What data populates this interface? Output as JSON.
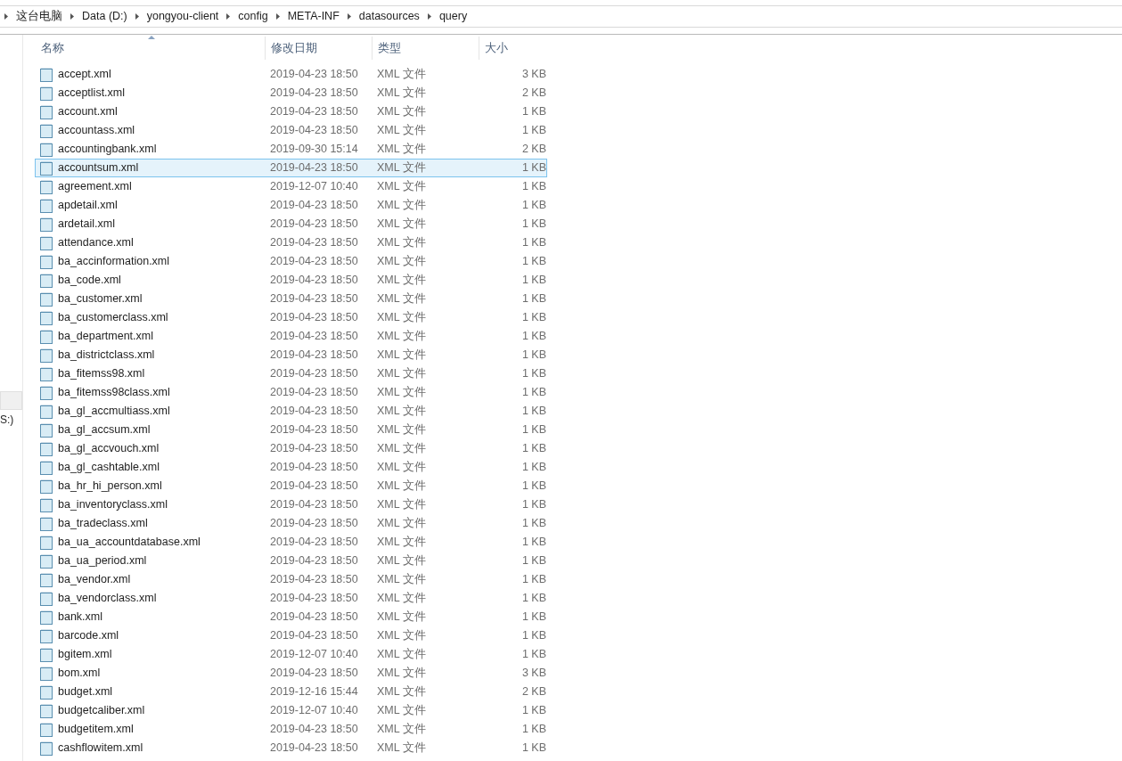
{
  "breadcrumb": [
    "这台电脑",
    "Data (D:)",
    "yongyou-client",
    "config",
    "META-INF",
    "datasources",
    "query"
  ],
  "sidebar": {
    "items": [
      {
        "selected": true
      },
      {
        "label": "S:)",
        "selected": false
      }
    ]
  },
  "table": {
    "columns": [
      {
        "label": "名称",
        "sorted": true
      },
      {
        "label": "修改日期",
        "sorted": false
      },
      {
        "label": "类型",
        "sorted": false
      },
      {
        "label": "大小",
        "sorted": false
      }
    ],
    "rows": [
      {
        "name": "accept.xml",
        "date": "2019-04-23 18:50",
        "type": "XML 文件",
        "size": "3 KB",
        "selected": false
      },
      {
        "name": "acceptlist.xml",
        "date": "2019-04-23 18:50",
        "type": "XML 文件",
        "size": "2 KB",
        "selected": false
      },
      {
        "name": "account.xml",
        "date": "2019-04-23 18:50",
        "type": "XML 文件",
        "size": "1 KB",
        "selected": false
      },
      {
        "name": "accountass.xml",
        "date": "2019-04-23 18:50",
        "type": "XML 文件",
        "size": "1 KB",
        "selected": false
      },
      {
        "name": "accountingbank.xml",
        "date": "2019-09-30 15:14",
        "type": "XML 文件",
        "size": "2 KB",
        "selected": false
      },
      {
        "name": "accountsum.xml",
        "date": "2019-04-23 18:50",
        "type": "XML 文件",
        "size": "1 KB",
        "selected": true
      },
      {
        "name": "agreement.xml",
        "date": "2019-12-07 10:40",
        "type": "XML 文件",
        "size": "1 KB",
        "selected": false
      },
      {
        "name": "apdetail.xml",
        "date": "2019-04-23 18:50",
        "type": "XML 文件",
        "size": "1 KB",
        "selected": false
      },
      {
        "name": "ardetail.xml",
        "date": "2019-04-23 18:50",
        "type": "XML 文件",
        "size": "1 KB",
        "selected": false
      },
      {
        "name": "attendance.xml",
        "date": "2019-04-23 18:50",
        "type": "XML 文件",
        "size": "1 KB",
        "selected": false
      },
      {
        "name": "ba_accinformation.xml",
        "date": "2019-04-23 18:50",
        "type": "XML 文件",
        "size": "1 KB",
        "selected": false
      },
      {
        "name": "ba_code.xml",
        "date": "2019-04-23 18:50",
        "type": "XML 文件",
        "size": "1 KB",
        "selected": false
      },
      {
        "name": "ba_customer.xml",
        "date": "2019-04-23 18:50",
        "type": "XML 文件",
        "size": "1 KB",
        "selected": false
      },
      {
        "name": "ba_customerclass.xml",
        "date": "2019-04-23 18:50",
        "type": "XML 文件",
        "size": "1 KB",
        "selected": false
      },
      {
        "name": "ba_department.xml",
        "date": "2019-04-23 18:50",
        "type": "XML 文件",
        "size": "1 KB",
        "selected": false
      },
      {
        "name": "ba_districtclass.xml",
        "date": "2019-04-23 18:50",
        "type": "XML 文件",
        "size": "1 KB",
        "selected": false
      },
      {
        "name": "ba_fitemss98.xml",
        "date": "2019-04-23 18:50",
        "type": "XML 文件",
        "size": "1 KB",
        "selected": false
      },
      {
        "name": "ba_fitemss98class.xml",
        "date": "2019-04-23 18:50",
        "type": "XML 文件",
        "size": "1 KB",
        "selected": false
      },
      {
        "name": "ba_gl_accmultiass.xml",
        "date": "2019-04-23 18:50",
        "type": "XML 文件",
        "size": "1 KB",
        "selected": false
      },
      {
        "name": "ba_gl_accsum.xml",
        "date": "2019-04-23 18:50",
        "type": "XML 文件",
        "size": "1 KB",
        "selected": false
      },
      {
        "name": "ba_gl_accvouch.xml",
        "date": "2019-04-23 18:50",
        "type": "XML 文件",
        "size": "1 KB",
        "selected": false
      },
      {
        "name": "ba_gl_cashtable.xml",
        "date": "2019-04-23 18:50",
        "type": "XML 文件",
        "size": "1 KB",
        "selected": false
      },
      {
        "name": "ba_hr_hi_person.xml",
        "date": "2019-04-23 18:50",
        "type": "XML 文件",
        "size": "1 KB",
        "selected": false
      },
      {
        "name": "ba_inventoryclass.xml",
        "date": "2019-04-23 18:50",
        "type": "XML 文件",
        "size": "1 KB",
        "selected": false
      },
      {
        "name": "ba_tradeclass.xml",
        "date": "2019-04-23 18:50",
        "type": "XML 文件",
        "size": "1 KB",
        "selected": false
      },
      {
        "name": "ba_ua_accountdatabase.xml",
        "date": "2019-04-23 18:50",
        "type": "XML 文件",
        "size": "1 KB",
        "selected": false
      },
      {
        "name": "ba_ua_period.xml",
        "date": "2019-04-23 18:50",
        "type": "XML 文件",
        "size": "1 KB",
        "selected": false
      },
      {
        "name": "ba_vendor.xml",
        "date": "2019-04-23 18:50",
        "type": "XML 文件",
        "size": "1 KB",
        "selected": false
      },
      {
        "name": "ba_vendorclass.xml",
        "date": "2019-04-23 18:50",
        "type": "XML 文件",
        "size": "1 KB",
        "selected": false
      },
      {
        "name": "bank.xml",
        "date": "2019-04-23 18:50",
        "type": "XML 文件",
        "size": "1 KB",
        "selected": false
      },
      {
        "name": "barcode.xml",
        "date": "2019-04-23 18:50",
        "type": "XML 文件",
        "size": "1 KB",
        "selected": false
      },
      {
        "name": "bgitem.xml",
        "date": "2019-12-07 10:40",
        "type": "XML 文件",
        "size": "1 KB",
        "selected": false
      },
      {
        "name": "bom.xml",
        "date": "2019-04-23 18:50",
        "type": "XML 文件",
        "size": "3 KB",
        "selected": false
      },
      {
        "name": "budget.xml",
        "date": "2019-12-16 15:44",
        "type": "XML 文件",
        "size": "2 KB",
        "selected": false
      },
      {
        "name": "budgetcaliber.xml",
        "date": "2019-12-07 10:40",
        "type": "XML 文件",
        "size": "1 KB",
        "selected": false
      },
      {
        "name": "budgetitem.xml",
        "date": "2019-04-23 18:50",
        "type": "XML 文件",
        "size": "1 KB",
        "selected": false
      },
      {
        "name": "cashflowitem.xml",
        "date": "2019-04-23 18:50",
        "type": "XML 文件",
        "size": "1 KB",
        "selected": false
      }
    ]
  }
}
